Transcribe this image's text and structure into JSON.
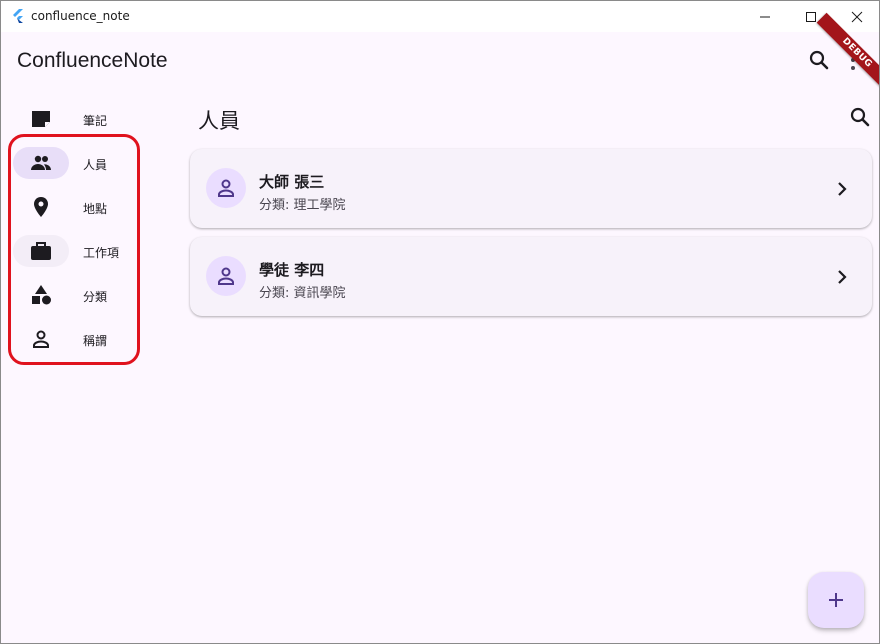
{
  "window": {
    "title": "confluence_note",
    "icon": "flutter-logo-icon",
    "controls": [
      "minimize-icon",
      "maximize-icon",
      "close-icon"
    ]
  },
  "appbar": {
    "title": "ConfluenceNote",
    "debug_banner": "DEBUG"
  },
  "rail": {
    "items": [
      {
        "label": "筆記",
        "icon": "note-icon"
      },
      {
        "label": "人員",
        "icon": "people-icon",
        "selected": true
      },
      {
        "label": "地點",
        "icon": "place-icon"
      },
      {
        "label": "工作項",
        "icon": "briefcase-icon"
      },
      {
        "label": "分類",
        "icon": "category-shapes-icon"
      },
      {
        "label": "稱謂",
        "icon": "person-icon"
      }
    ]
  },
  "main": {
    "title": "人員",
    "cards": [
      {
        "name": "大師 張三",
        "subtitle": "分類: 理工學院"
      },
      {
        "name": "學徒 李四",
        "subtitle": "分類: 資訊學院"
      }
    ]
  },
  "fab": {
    "icon": "add-icon"
  },
  "colors": {
    "background": "#fdf7ff",
    "selected_pill": "#e8def8",
    "avatar": "#eaddff",
    "card": "#f7f2fa",
    "highlight": "#e0121e",
    "debug_banner": "#a3151a"
  }
}
